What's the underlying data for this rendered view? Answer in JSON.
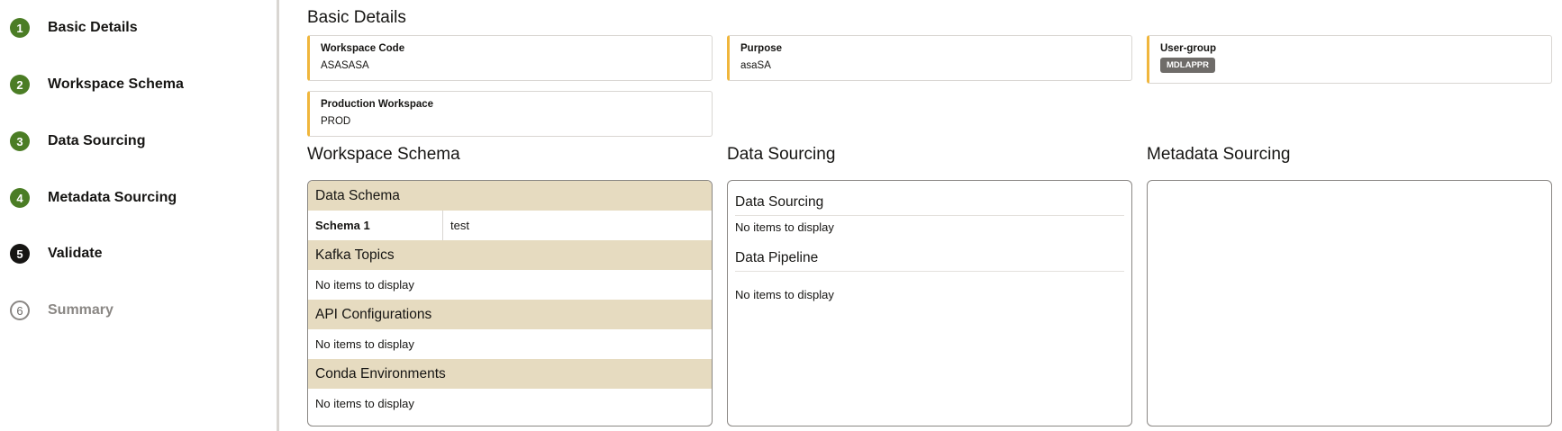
{
  "stepper": {
    "steps": [
      {
        "number": "1",
        "label": "Basic Details",
        "state": "done"
      },
      {
        "number": "2",
        "label": "Workspace Schema",
        "state": "done"
      },
      {
        "number": "3",
        "label": "Data Sourcing",
        "state": "done"
      },
      {
        "number": "4",
        "label": "Metadata Sourcing",
        "state": "done"
      },
      {
        "number": "5",
        "label": "Validate",
        "state": "current"
      },
      {
        "number": "6",
        "label": "Summary",
        "state": "pending"
      }
    ]
  },
  "basic_details": {
    "title": "Basic Details",
    "workspace_code": {
      "label": "Workspace Code",
      "value": "ASASASA"
    },
    "purpose": {
      "label": "Purpose",
      "value": "asaSA"
    },
    "user_group": {
      "label": "User-group",
      "value": "MDLAPPR"
    },
    "production_workspace": {
      "label": "Production Workspace",
      "value": "PROD"
    }
  },
  "workspace_schema": {
    "title": "Workspace Schema",
    "data_schema": {
      "header": "Data Schema",
      "rows": [
        {
          "key": "Schema 1",
          "value": "test"
        }
      ]
    },
    "kafka_topics": {
      "header": "Kafka Topics",
      "empty": "No items to display"
    },
    "api_configurations": {
      "header": "API Configurations",
      "empty": "No items to display"
    },
    "conda_environments": {
      "header": "Conda Environments",
      "empty": "No items to display"
    }
  },
  "data_sourcing": {
    "title": "Data Sourcing",
    "data_sourcing": {
      "subtitle": "Data Sourcing",
      "empty": "No items to display"
    },
    "data_pipeline": {
      "subtitle": "Data Pipeline",
      "empty": "No items to display"
    }
  },
  "metadata_sourcing": {
    "title": "Metadata Sourcing"
  },
  "colors": {
    "step_done": "#4b7d25",
    "step_current": "#161513",
    "card_accent": "#f0b63c",
    "panel_header_bg": "#e6dbc0",
    "chip_bg": "#6f6c69"
  }
}
